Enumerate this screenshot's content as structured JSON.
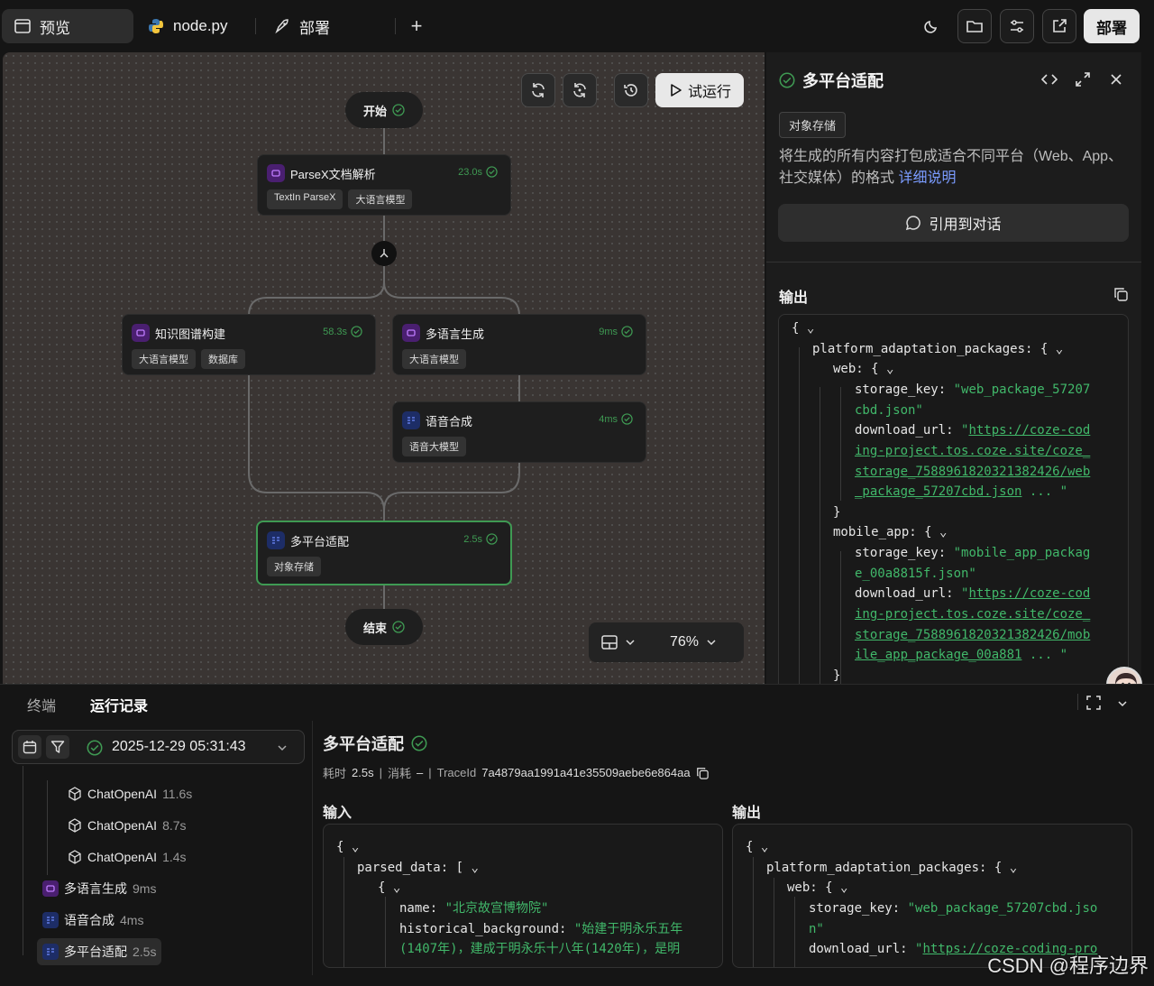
{
  "topbar": {
    "tabs": [
      {
        "label": "预览",
        "icon": "window-icon"
      },
      {
        "label": "node.py",
        "icon": "python-icon"
      },
      {
        "label": "部署",
        "icon": "rocket-icon"
      }
    ],
    "add_label": "+",
    "deploy_label": "部署"
  },
  "canvas": {
    "run_label": "试运行",
    "start_label": "开始",
    "end_label": "结束",
    "zoom": "76%",
    "nodes": {
      "parsex": {
        "title": "ParseX文档解析",
        "time": "23.0s",
        "tags": [
          "TextIn ParseX",
          "大语言模型"
        ]
      },
      "kg": {
        "title": "知识图谱构建",
        "time": "58.3s",
        "tags": [
          "大语言模型",
          "数据库"
        ]
      },
      "multilang": {
        "title": "多语言生成",
        "time": "9ms",
        "tags": [
          "大语言模型"
        ]
      },
      "tts": {
        "title": "语音合成",
        "time": "4ms",
        "tags": [
          "语音大模型"
        ]
      },
      "multiplatform": {
        "title": "多平台适配",
        "time": "2.5s",
        "tags": [
          "对象存储"
        ]
      }
    }
  },
  "panel": {
    "title": "多平台适配",
    "tag": "对象存储",
    "description": "将生成的所有内容打包成适合不同平台（Web、App、社交媒体）的格式",
    "detail_link": "详细说明",
    "cite_label": "引用到对话",
    "output_label": "输出",
    "code": {
      "k_root": "platform_adaptation_packages:",
      "k_web": "web:",
      "k_storage": "storage_key:",
      "k_download": "download_url:",
      "k_mobile": "mobile_app:",
      "web_key_1": "\"web_package_57207",
      "web_key_2": "cbd.json\"",
      "web_url_1": "https://coze-cod",
      "web_url_2": "ing-project.tos.coze.site/coze_",
      "web_url_3": "storage_7588961820321382426/web",
      "web_url_4": "_package_57207cbd.json",
      "mob_key_1": "\"mobile_app_packag",
      "mob_key_2": "e_00a8815f.json\"",
      "mob_url_1": "https://coze-cod",
      "mob_url_2": "ing-project.tos.coze.site/coze_",
      "mob_url_3": "storage_7588961820321382426/mob",
      "mob_url_4": "ile_app_package_00a881",
      "ellipsis": "... \""
    }
  },
  "bottom": {
    "tab_terminal": "终端",
    "tab_runs": "运行记录",
    "run_time": "2025-12-29 05:31:43",
    "tree": [
      {
        "label": "ChatOpenAI",
        "dur": "11.6s"
      },
      {
        "label": "ChatOpenAI",
        "dur": "8.7s"
      },
      {
        "label": "ChatOpenAI",
        "dur": "1.4s"
      },
      {
        "label": "多语言生成",
        "dur": "9ms"
      },
      {
        "label": "语音合成",
        "dur": "4ms"
      },
      {
        "label": "多平台适配",
        "dur": "2.5s"
      }
    ],
    "detail": {
      "title": "多平台适配",
      "meta_time_label": "耗时",
      "meta_time": "2.5s",
      "meta_cost_label": "消耗",
      "meta_cost": "–",
      "meta_trace_label": "TraceId",
      "meta_trace": "7a4879aa1991a41e35509aebe6e864aa",
      "input_label": "输入",
      "output_label": "输出",
      "in_parsed": "parsed_data:",
      "in_name_k": "name:",
      "in_name_v": "\"北京故宫博物院\"",
      "in_hist_k": "historical_background:",
      "in_hist_v1": "\"始建于明永乐五年",
      "in_hist_v2": "(1407年)，建成于明永乐十八年(1420年)，是明",
      "out_root": "platform_adaptation_packages:",
      "out_web": "web:",
      "out_storage_k": "storage_key:",
      "out_storage_v1": "\"web_package_57207cbd.jso",
      "out_storage_v2": "n\"",
      "out_download_k": "download_url:",
      "out_download_v": "https://coze-coding-pro"
    }
  },
  "watermark": "CSDN @程序边界"
}
